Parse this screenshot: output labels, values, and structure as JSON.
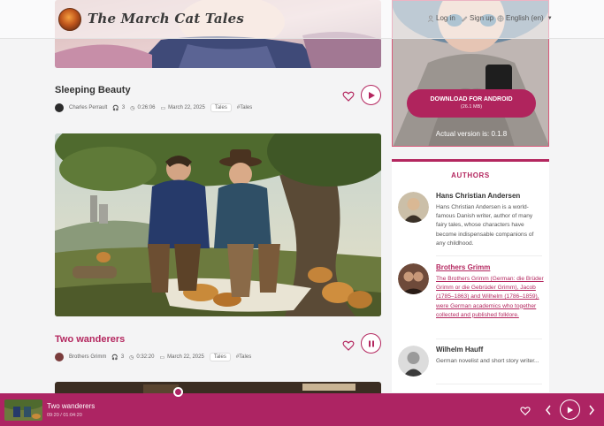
{
  "header": {
    "logo_text": "The March Cat Tales",
    "login": "Log in",
    "signup": "Sign up",
    "language": "English (en)"
  },
  "stories": [
    {
      "title": "Sleeping Beauty",
      "author": "Charles Perrault",
      "listens": "3",
      "duration": "0:26:06",
      "date": "March 22, 2025",
      "category": "Tales",
      "tag": "#Tales"
    },
    {
      "title": "Two wanderers",
      "author": "Brothers Grimm",
      "listens": "3",
      "duration": "0:32:20",
      "date": "March 22, 2025",
      "category": "Tales",
      "tag": "#Tales"
    }
  ],
  "download": {
    "button_label": "DOWNLOAD FOR ANDROID",
    "size": "(26.1 MB)",
    "version": "Actual version is: 0.1.8"
  },
  "authors": {
    "title": "AUTHORS",
    "items": [
      {
        "name": "Hans Christian Andersen",
        "desc": "Hans Christian Andersen is a world-famous Danish writer, author of many fairy tales, whose characters have become indispensable companions of any childhood."
      },
      {
        "name": "Brothers Grimm",
        "desc": "The Brothers Grimm (German: die Brüder Grimm or die Gebrüder Grimm), Jacob (1785–1863) and Wilhelm (1786–1859), were German academics who together collected and published folklore."
      },
      {
        "name": "Wilhelm Hauff",
        "desc": "German novelist and short story writer..."
      }
    ]
  },
  "player": {
    "title": "Two wanderers",
    "time": "09:20 / 01:04:20"
  },
  "colors": {
    "accent": "#b4275f",
    "player_bg": "#ad2463"
  }
}
